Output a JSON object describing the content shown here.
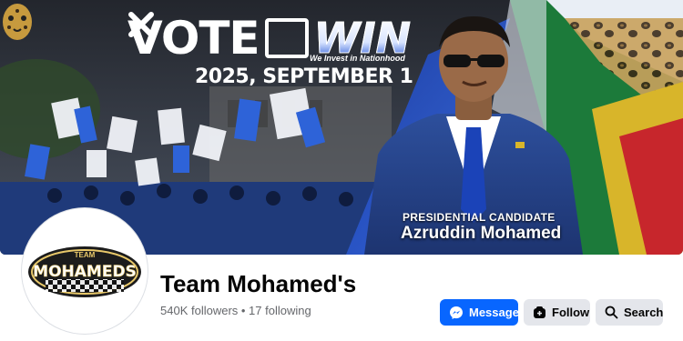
{
  "cover": {
    "headline_vote": "VOTE",
    "headline_win": "WIN",
    "tagline": "We Invest in Nationhood",
    "date": "2025, SEPTEMBER 1",
    "candidate_title": "PRESIDENTIAL CANDIDATE",
    "candidate_name": "Azruddin Mohamed"
  },
  "profile": {
    "logo_top": "TEAM",
    "logo_main": "MOHAMEDS",
    "name": "Team Mohamed's",
    "stats": "540K followers • 17 following"
  },
  "actions": {
    "message_label": "Message",
    "follow_label": "Follow",
    "search_label": "Search"
  },
  "colors": {
    "primary_button": "#0866ff",
    "secondary_button": "#e4e6eb",
    "campaign_blue": "#2a56c9"
  },
  "icons": [
    "messenger-icon",
    "follow-icon",
    "search-icon",
    "x-mark-icon",
    "jaguar-icon"
  ]
}
